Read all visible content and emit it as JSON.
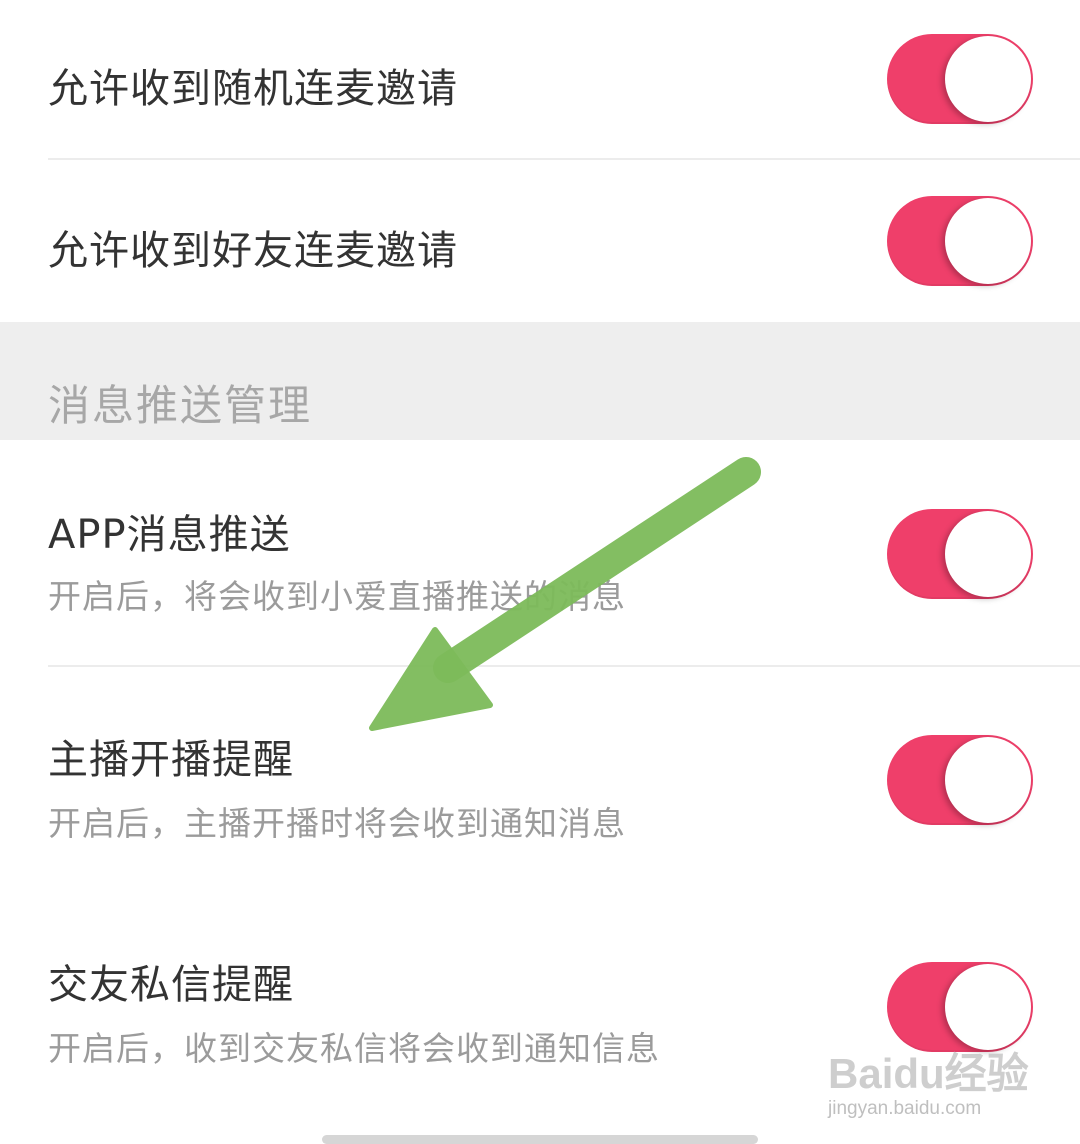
{
  "settings_top": [
    {
      "label": "允许收到随机连麦邀请",
      "enabled": true
    },
    {
      "label": "允许收到好友连麦邀请",
      "enabled": true
    }
  ],
  "section": {
    "title": "消息推送管理"
  },
  "push_settings": [
    {
      "label": "APP消息推送",
      "description": "开启后，将会收到小爱直播推送的消息",
      "enabled": true
    },
    {
      "label": "主播开播提醒",
      "description": "开启后，主播开播时将会收到通知消息",
      "enabled": true
    },
    {
      "label": "交友私信提醒",
      "description": "开启后，收到交友私信将会收到通知信息",
      "enabled": true
    }
  ],
  "colors": {
    "toggle_on": "#ef3f6a",
    "annotation_arrow": "#7dbb5a"
  },
  "watermark": {
    "logo": "Baidu经验",
    "url": "jingyan.baidu.com"
  }
}
